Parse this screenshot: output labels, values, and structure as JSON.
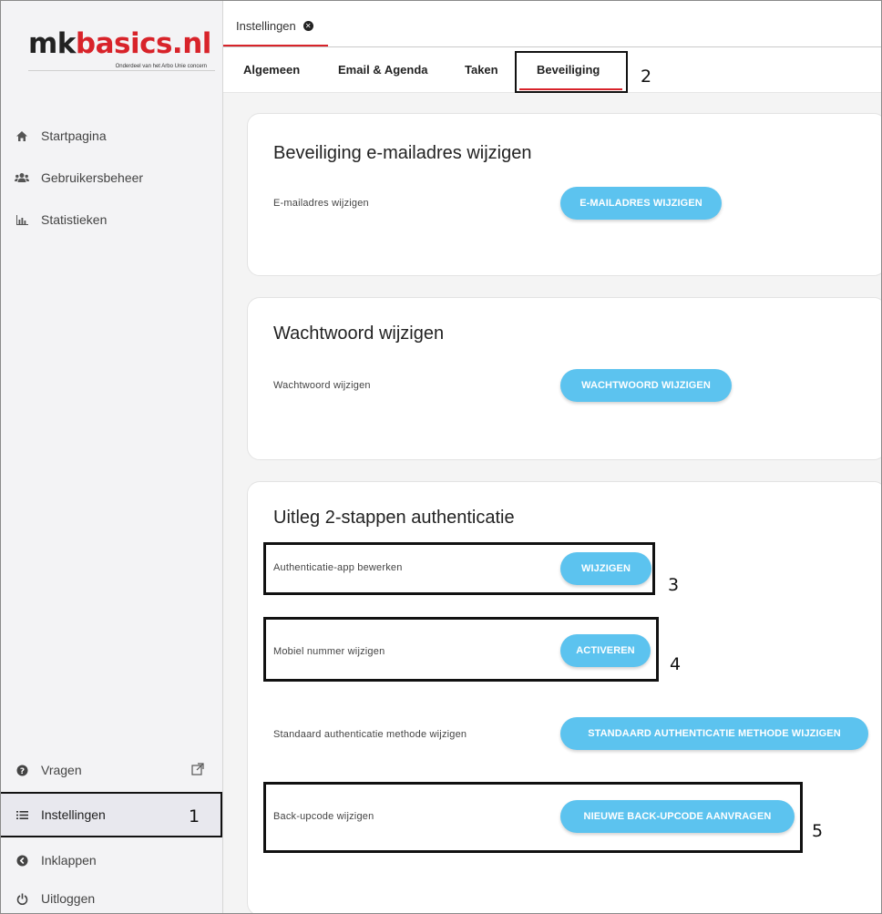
{
  "logo": {
    "part1": "mk",
    "part2": "basics.nl",
    "subtitle": "Onderdeel van het Arbo Unie concern"
  },
  "sidebar": {
    "items": [
      {
        "label": "Startpagina",
        "icon": "home-icon"
      },
      {
        "label": "Gebruikersbeheer",
        "icon": "users-icon"
      },
      {
        "label": "Statistieken",
        "icon": "bar-chart-icon"
      }
    ],
    "bottom": [
      {
        "label": "Vragen",
        "icon": "question-icon"
      },
      {
        "label": "Instellingen",
        "icon": "list-icon"
      },
      {
        "label": "Inklappen",
        "icon": "collapse-icon"
      },
      {
        "label": "Uitloggen",
        "icon": "power-icon"
      }
    ]
  },
  "topbar": {
    "tab_label": "Instellingen"
  },
  "tabs": [
    "Algemeen",
    "Email & Agenda",
    "Taken",
    "Beveiliging"
  ],
  "cards": {
    "email": {
      "title": "Beveiliging e-mailadres wijzigen",
      "row_label": "E-mailadres wijzigen",
      "button": "E-MAILADRES WIJZIGEN"
    },
    "password": {
      "title": "Wachtwoord wijzigen",
      "row_label": "Wachtwoord wijzigen",
      "button": "WACHTWOORD WIJZIGEN"
    },
    "twofa": {
      "title": "Uitleg 2-stappen authenticatie",
      "rows": [
        {
          "label": "Authenticatie-app bewerken",
          "button": "WIJZIGEN"
        },
        {
          "label": "Mobiel nummer wijzigen",
          "button": "ACTIVEREN"
        },
        {
          "label": "Standaard authenticatie methode wijzigen",
          "button": "STANDAARD AUTHENTICATIE METHODE WIJZIGEN"
        },
        {
          "label": "Back-upcode wijzigen",
          "button": "NIEUWE BACK-UPCODE AANVRAGEN"
        }
      ]
    }
  },
  "annotations": [
    "1",
    "2",
    "3",
    "4",
    "5"
  ],
  "colors": {
    "accent_red": "#d8232a",
    "button_blue": "#5cc3ef",
    "sidebar_bg": "#f3f3f5"
  }
}
